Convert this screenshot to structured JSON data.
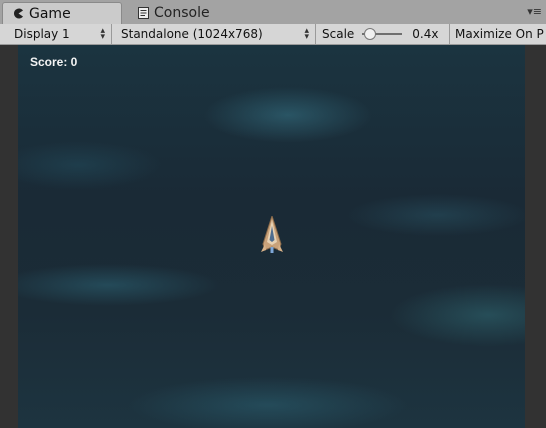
{
  "tabs": [
    {
      "label": "Game",
      "icon": "pacman-icon",
      "active": true
    },
    {
      "label": "Console",
      "icon": "console-icon",
      "active": false
    }
  ],
  "toolbar": {
    "display_label": "Display 1",
    "resolution_label": "Standalone (1024x768)",
    "scale_label": "Scale",
    "scale_value": "0.4x",
    "scale_fraction": 0.05,
    "maximize_label": "Maximize On P"
  },
  "game": {
    "score_text": "Score: 0"
  },
  "colors": {
    "tabbar": "#a3a3a3",
    "toolbar": "#d6d6d6",
    "background_deep": "#1a2a36",
    "nebula_teal": "#3c8296"
  }
}
